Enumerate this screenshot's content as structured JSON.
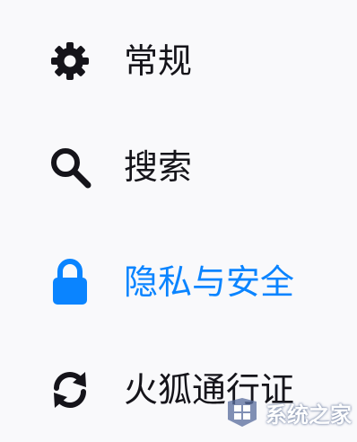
{
  "sidebar": {
    "items": [
      {
        "id": "general",
        "label": "常规",
        "icon": "gear-icon",
        "selected": false
      },
      {
        "id": "search",
        "label": "搜索",
        "icon": "search-icon",
        "selected": false
      },
      {
        "id": "privacy",
        "label": "隐私与安全",
        "icon": "lock-icon",
        "selected": true
      },
      {
        "id": "sync",
        "label": "火狐通行证",
        "icon": "sync-icon",
        "selected": false
      }
    ]
  },
  "colors": {
    "text": "#15141a",
    "accent": "#0a84ff",
    "background": "#f9f9fb"
  },
  "watermark": {
    "text": "系统之家",
    "logo": "windows-logo-icon"
  }
}
